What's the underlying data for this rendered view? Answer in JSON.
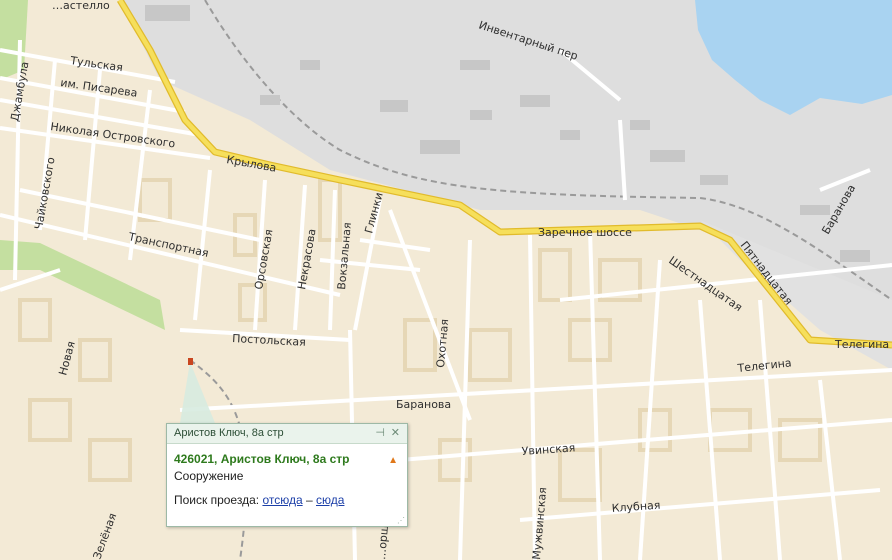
{
  "map": {
    "streets": {
      "kastello": "…астелло",
      "tulskaya": "Тульская",
      "pisareva": "им. Писарева",
      "dzhambula": "Джамбула",
      "ostrovskogo": "Николая Островского",
      "chaikovskogo": "Чайковского",
      "krylova": "Крылова",
      "transportnaya": "Транспортная",
      "orsovskaya": "Орсовская",
      "nekrasova": "Некрасова",
      "vokzalnaya": "Вокзальная",
      "glinki": "Глинки",
      "postolskaya": "Постольская",
      "inventarny": "Инвентарный пер",
      "zarechnoe": "Заречное шоссе",
      "shestnadtsataya": "Шестнадцатая",
      "pyatnadtsataya": "Пятнадцатая",
      "baranova_ne": "Баранова",
      "baranova": "Баранова",
      "telegina_e": "Телегина",
      "telegina": "Телегина",
      "okhotnaya": "Охотная",
      "novaya": "Новая",
      "uvinskaya": "Увинская",
      "muzhvinskaya": "Мужвинская",
      "klubnaya": "Клубная",
      "zelenaya": "Зелёная",
      "gorshechnaya": "…оршечная"
    }
  },
  "popup": {
    "title": "Аристов Ключ, 8а стр",
    "pin_icon": "pin-icon",
    "close_icon": "close-icon",
    "address": "426021, Аристов Ключ, 8а стр",
    "kind": "Сооружение",
    "route_label": "Поиск проезда:",
    "from_link": "отсюда",
    "dash": "–",
    "to_link": "сюда"
  },
  "colors": {
    "background": "#f3ead6",
    "water": "#a9d3f1",
    "industrial": "#dcdcdc",
    "main_road": "#f5d94a",
    "street": "#ffffff",
    "park": "#c4dfa0"
  }
}
